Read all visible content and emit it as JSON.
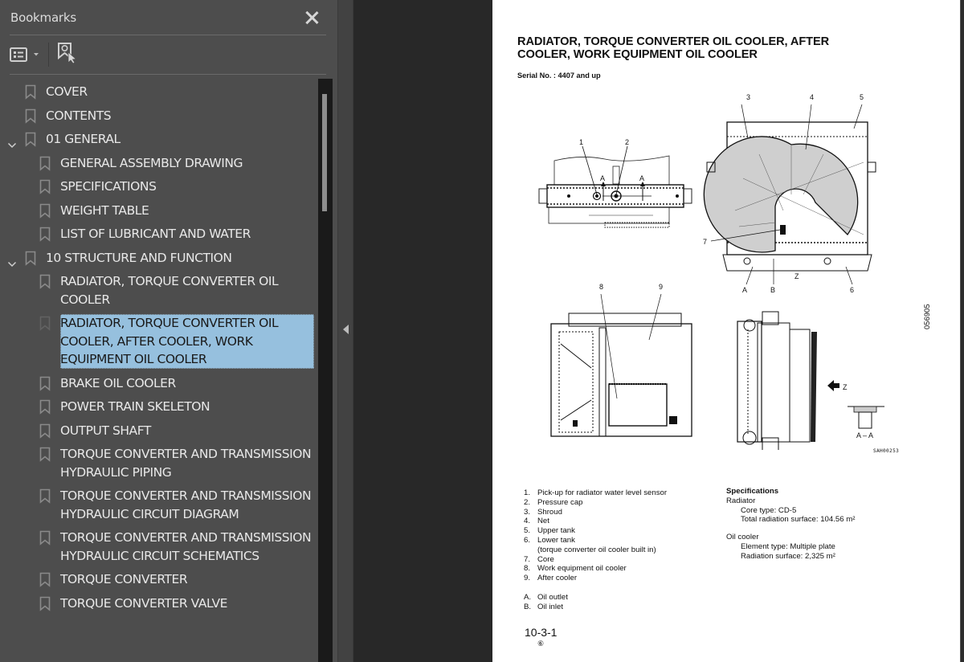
{
  "sidebar": {
    "title": "Bookmarks",
    "toolbar": {
      "options_icon": "list-options-icon",
      "find_icon": "find-current-bookmark-icon"
    },
    "items": [
      {
        "label": "COVER",
        "level": 0
      },
      {
        "label": "CONTENTS",
        "level": 0
      },
      {
        "label": "01 GENERAL",
        "level": 0,
        "expanded": true
      },
      {
        "label": "GENERAL ASSEMBLY DRAWING",
        "level": 1
      },
      {
        "label": "SPECIFICATIONS",
        "level": 1
      },
      {
        "label": "WEIGHT TABLE",
        "level": 1
      },
      {
        "label": "LIST OF LUBRICANT AND WATER",
        "level": 1
      },
      {
        "label": "10 STRUCTURE AND FUNCTION",
        "level": 0,
        "expanded": true
      },
      {
        "label": "RADIATOR, TORQUE CONVERTER OIL COOLER",
        "level": 1
      },
      {
        "label": "RADIATOR, TORQUE CONVERTER OIL COOLER, AFTER COOLER, WORK EQUIPMENT OIL COOLER",
        "level": 1,
        "selected": true
      },
      {
        "label": "BRAKE OIL COOLER",
        "level": 1
      },
      {
        "label": "POWER TRAIN SKELETON",
        "level": 1
      },
      {
        "label": "OUTPUT SHAFT",
        "level": 1
      },
      {
        "label": "TORQUE CONVERTER AND TRANSMISSION HYDRAULIC PIPING",
        "level": 1
      },
      {
        "label": "TORQUE CONVERTER AND TRANSMISSION HYDRAULIC CIRCUIT DIAGRAM",
        "level": 1
      },
      {
        "label": "TORQUE CONVERTER AND TRANSMISSION HYDRAULIC CIRCUIT SCHEMATICS",
        "level": 1
      },
      {
        "label": "TORQUE CONVERTER",
        "level": 1
      },
      {
        "label": "TORQUE CONVERTER VALVE",
        "level": 1
      }
    ],
    "selected_color": "#96c0de"
  },
  "page": {
    "title": "RADIATOR, TORQUE CONVERTER OIL COOLER, AFTER COOLER, WORK EQUIPMENT OIL COOLER",
    "serial": "Serial No. : 4407 and up",
    "side_code": "056905",
    "figure_ref": "SAH00253",
    "callouts": {
      "n1": "1",
      "n2": "2",
      "n3": "3",
      "n4": "4",
      "n5": "5",
      "n6": "6",
      "n7": "7",
      "n8": "8",
      "n9": "9",
      "A": "A",
      "B": "B",
      "Z": "Z",
      "section": "A – A"
    },
    "legend": [
      {
        "num": "1.",
        "text": "Pick-up for radiator water level sensor"
      },
      {
        "num": "2.",
        "text": "Pressure cap"
      },
      {
        "num": "3.",
        "text": "Shroud"
      },
      {
        "num": "4.",
        "text": "Net"
      },
      {
        "num": "5.",
        "text": "Upper tank"
      },
      {
        "num": "6.",
        "text": "Lower tank"
      },
      {
        "num": "",
        "text": "(torque converter oil cooler built in)"
      },
      {
        "num": "7.",
        "text": "Core"
      },
      {
        "num": "8.",
        "text": "Work equipment oil cooler"
      },
      {
        "num": "9.",
        "text": "After cooler"
      }
    ],
    "ports": [
      {
        "num": "A.",
        "text": "Oil outlet"
      },
      {
        "num": "B.",
        "text": "Oil inlet"
      }
    ],
    "specifications": {
      "heading": "Specifications",
      "radiator_label": "Radiator",
      "radiator_core": "Core type: CD-5",
      "radiator_surface": "Total radiation surface: 104.56 m²",
      "oil_cooler_label": "Oil cooler",
      "oil_element": "Element type: Multiple plate",
      "oil_surface": "Radiation surface: 2,325 m²"
    },
    "page_number": "10-3-1",
    "revision": "⑥"
  }
}
